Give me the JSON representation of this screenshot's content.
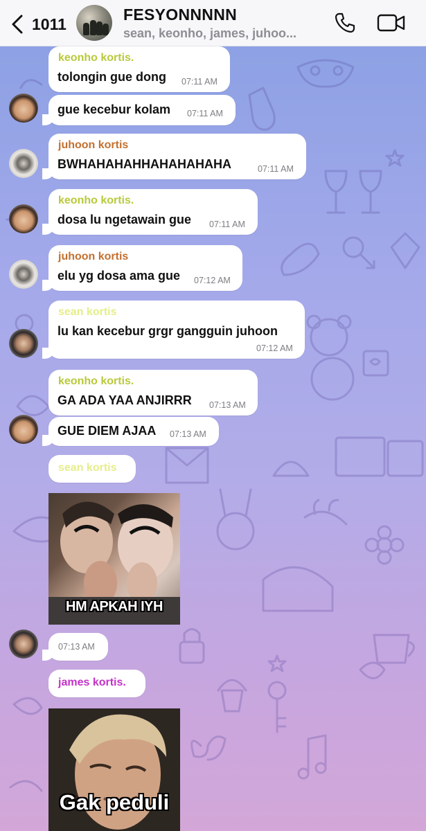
{
  "header": {
    "back_count": "1011",
    "title": "FESYONNNNN",
    "members": "sean, keonho, james, juhoo...",
    "icons": {
      "back": "chevron-left-icon",
      "call": "phone-icon",
      "video": "video-camera-icon"
    }
  },
  "colors": {
    "keonho": "#b9c93a",
    "juhoon": "#c3702f",
    "sean": "#e5ee8a",
    "james": "#c531c9"
  },
  "messages": [
    {
      "sender": "keonho kortis.",
      "text": "tolongin gue dong",
      "time": "07:11 AM"
    },
    {
      "text": "gue kecebur kolam",
      "time": "07:11 AM"
    },
    {
      "sender": "juhoon kortis",
      "text": "BWHAHAHAHHAHAHAHAHA",
      "time": "07:11 AM"
    },
    {
      "sender": "keonho kortis.",
      "text": "dosa lu ngetawain gue",
      "time": "07:11 AM"
    },
    {
      "sender": "juhoon kortis",
      "text": "elu yg dosa ama gue",
      "time": "07:12 AM"
    },
    {
      "sender": "sean kortis",
      "text": "lu kan kecebur grgr gangguin juhoon",
      "time": "07:12 AM"
    },
    {
      "sender": "keonho kortis.",
      "text": "GA ADA YAA ANJIRRR",
      "time": "07:13 AM"
    },
    {
      "text": "GUE DIEM AJAA",
      "time": "07:13 AM"
    },
    {
      "sender": "sean kortis",
      "sticker_caption": "HM APKAH IYH",
      "time": "07:13 AM"
    },
    {
      "sender": "james kortis.",
      "sticker_caption": "Gak peduli"
    }
  ]
}
